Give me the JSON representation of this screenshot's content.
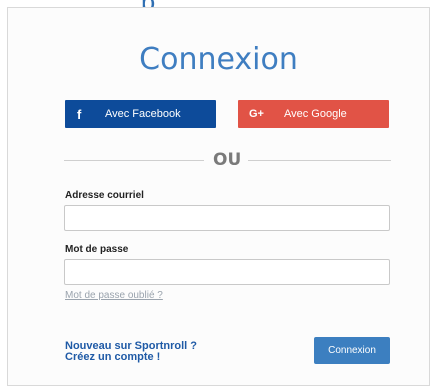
{
  "title": "Connexion",
  "top_partial_text": "p",
  "social": {
    "facebook": {
      "icon_char": "f",
      "label": "Avec Facebook",
      "color": "#0d4b9a"
    },
    "google": {
      "icon_char": "G+",
      "label": "Avec Google",
      "color": "#e15346"
    }
  },
  "divider_text": "OU",
  "email": {
    "label": "Adresse courriel",
    "value": "",
    "placeholder": ""
  },
  "password": {
    "label": "Mot de passe",
    "value": "",
    "placeholder": ""
  },
  "forgot_password": "Mot de passe oublié ?",
  "signup": {
    "line1": "Nouveau sur Sportnroll ?",
    "line2": "Créez un compte !"
  },
  "submit_label": "Connexion",
  "colors": {
    "accent": "#3c7fc0",
    "title": "#3f7ec1",
    "link": "#1f5aa6"
  }
}
